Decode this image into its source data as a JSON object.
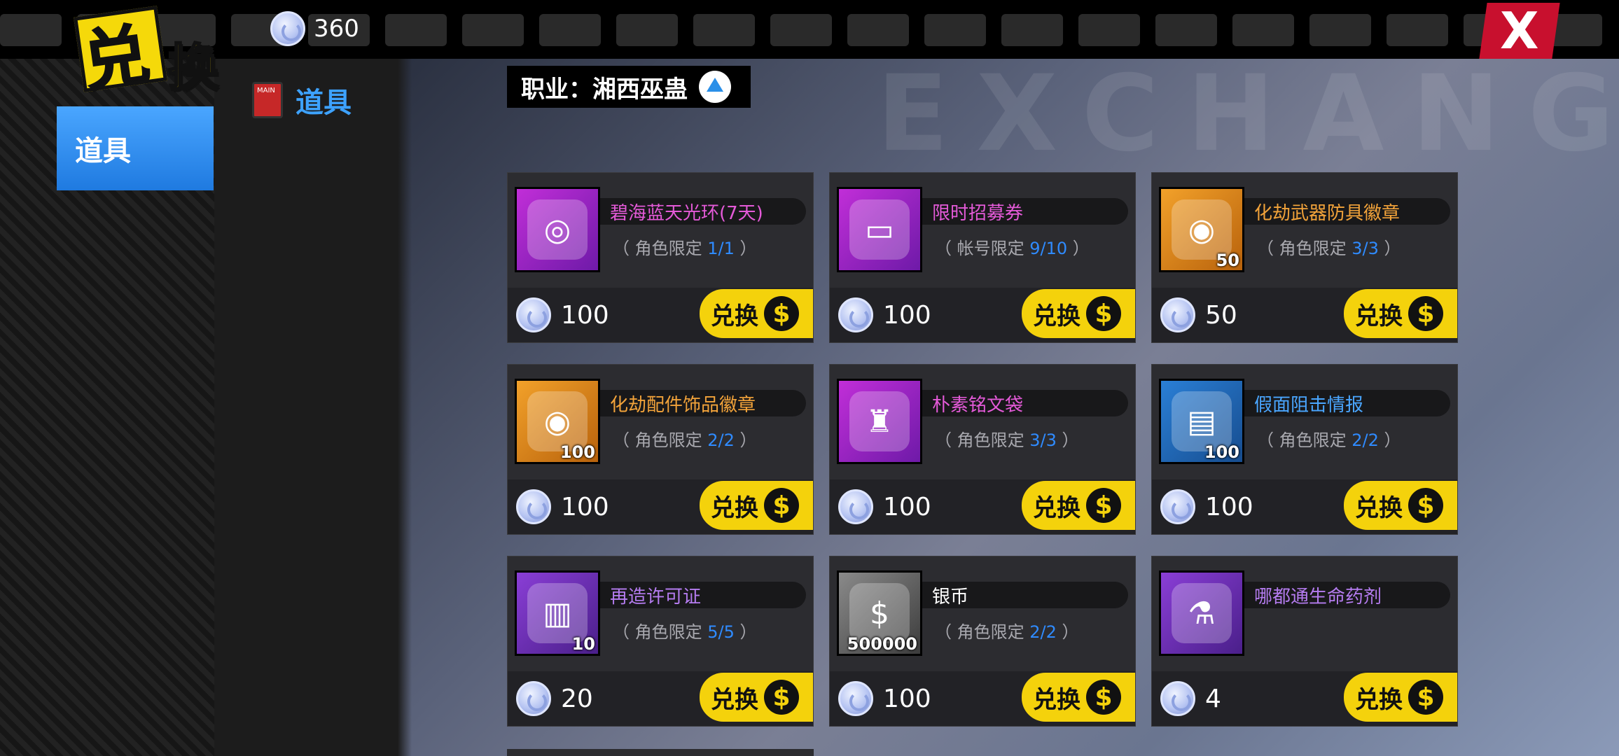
{
  "header": {
    "logo_char1": "兑",
    "logo_char2": "换",
    "currency_amount": "360",
    "close_label": "X"
  },
  "sidebar": {
    "category_tab": "道具",
    "sub_item": "道具",
    "sub_item_icon_text": "MAIN"
  },
  "main": {
    "background_text": "EXCHANGE",
    "class_selector": "职业：湘西巫蛊"
  },
  "buy_label": "兑换",
  "items": [
    {
      "name": "碧海蓝天光环(7天)",
      "name_color": "#e45ad8",
      "limit_prefix": "（ 角色限定  ",
      "limit": "1/1",
      "limit_suffix": " ）",
      "price": "100",
      "qty": "",
      "frame": "purple",
      "icon": "halo-icon",
      "glyph": "◎"
    },
    {
      "name": "限时招募券",
      "name_color": "#e45ad8",
      "limit_prefix": "（ 帐号限定  ",
      "limit": "9/10",
      "limit_suffix": " ）",
      "price": "100",
      "qty": "",
      "frame": "purple",
      "icon": "summon-ticket-icon",
      "glyph": "▭"
    },
    {
      "name": "化劫武器防具徽章",
      "name_color": "#f2a33a",
      "limit_prefix": "（ 角色限定  ",
      "limit": "3/3",
      "limit_suffix": " ）",
      "price": "50",
      "qty": "50",
      "frame": "orange",
      "icon": "medal-icon",
      "glyph": "◉"
    },
    {
      "name": "化劫配件饰品徽章",
      "name_color": "#f2a33a",
      "limit_prefix": "（ 角色限定  ",
      "limit": "2/2",
      "limit_suffix": " ）",
      "price": "100",
      "qty": "100",
      "frame": "orange",
      "icon": "medal-icon",
      "glyph": "◉"
    },
    {
      "name": "朴素铭文袋",
      "name_color": "#e45ad8",
      "limit_prefix": "（ 角色限定  ",
      "limit": "3/3",
      "limit_suffix": " ）",
      "price": "100",
      "qty": "",
      "frame": "purple",
      "icon": "pouch-icon",
      "glyph": "♜"
    },
    {
      "name": "假面阻击情报",
      "name_color": "#4aa6ff",
      "limit_prefix": "（ 角色限定  ",
      "limit": "2/2",
      "limit_suffix": " ）",
      "price": "100",
      "qty": "100",
      "frame": "blue",
      "icon": "document-icon",
      "glyph": "▤"
    },
    {
      "name": "再造许可证",
      "name_color": "#b57cf0",
      "limit_prefix": "（ 角色限定  ",
      "limit": "5/5",
      "limit_suffix": " ）",
      "price": "20",
      "qty": "10",
      "frame": "violet",
      "icon": "book-icon",
      "glyph": "▥"
    },
    {
      "name": "银币",
      "name_color": "#ffffff",
      "limit_prefix": "（ 角色限定  ",
      "limit": "2/2",
      "limit_suffix": " ）",
      "price": "100",
      "qty": "500000",
      "frame": "gray",
      "icon": "silver-coin-icon",
      "glyph": "$"
    },
    {
      "name": "哪都通生命药剂",
      "name_color": "#b57cf0",
      "limit_prefix": "",
      "limit": "",
      "limit_suffix": "",
      "price": "4",
      "qty": "",
      "frame": "violet",
      "icon": "potion-icon",
      "glyph": "⚗"
    }
  ]
}
